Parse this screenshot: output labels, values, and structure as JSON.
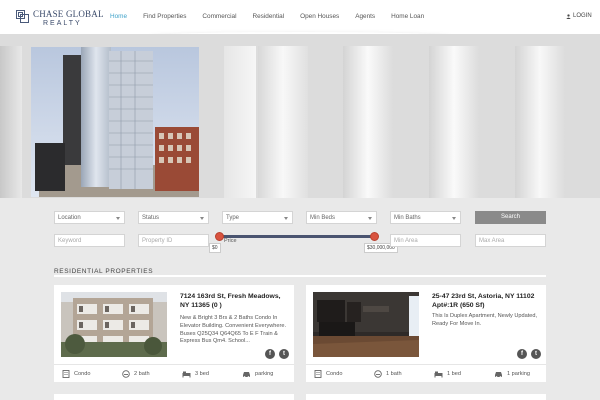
{
  "header": {
    "logo_line1": "CHASE GLOBAL",
    "logo_line2": "REALTY",
    "nav": [
      {
        "label": "Home",
        "active": true
      },
      {
        "label": "Find Properties",
        "active": false
      },
      {
        "label": "Commercial",
        "active": false
      },
      {
        "label": "Residential",
        "active": false
      },
      {
        "label": "Open Houses",
        "active": false
      },
      {
        "label": "Agents",
        "active": false
      },
      {
        "label": "Home Loan",
        "active": false
      }
    ],
    "login_label": "LOGIN",
    "active_color": "#3ea2c9"
  },
  "search": {
    "location": "Location",
    "status": "Status",
    "type": "Type",
    "min_beds": "Min Beds",
    "min_baths": "Min Baths",
    "search_button": "Search",
    "keyword_placeholder": "Keyword",
    "property_id_placeholder": "Property ID",
    "price_label": "Price",
    "price_min": "$0",
    "price_max": "$30,000,000",
    "min_area_placeholder": "Min Area",
    "max_area_placeholder": "Max Area",
    "handle_color": "#d9533f"
  },
  "section": {
    "title": "RESIDENTIAL PROPERTIES"
  },
  "listings": [
    {
      "title": "7124 163rd St, Fresh Meadows, NY 11365 (0 )",
      "description": "New & Bright 3 Brs & 2 Baths Condo In Elevator Building. Convenient Everywhere. Buses Q25Q34 Q64Q65 To E F Train & Express Bus Qm4. School...",
      "type": "Condo",
      "baths": "2 bath",
      "beds": "3 bed",
      "parking": "parking"
    },
    {
      "title": "25-47 23rd St, Astoria, NY 11102 Apt#:1R (650 Sf)",
      "description": "This Is Duplex Apartment, Newly Updated, Ready For Move In.",
      "type": "Condo",
      "baths": "1 bath",
      "beds": "1 bed",
      "parking": "1 parking"
    }
  ],
  "icons": {
    "facebook": "f",
    "twitter": "t"
  }
}
